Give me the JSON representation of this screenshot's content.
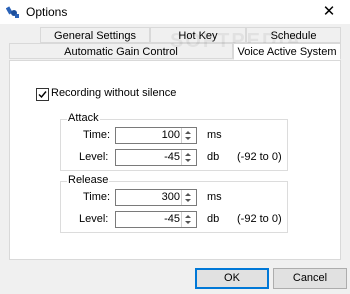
{
  "window": {
    "title": "Options",
    "icon": "app-satellite-icon",
    "close_glyph": "✕"
  },
  "tabs": {
    "row1": [
      "General Settings",
      "Hot Key",
      "Schedule"
    ],
    "row2": [
      "Automatic Gain Control",
      "Voice Active System"
    ],
    "active": "Voice Active System"
  },
  "voice": {
    "recording_without_silence_label": "Recording without silence",
    "recording_without_silence_checked": true,
    "attack": {
      "title": "Attack",
      "time_label": "Time:",
      "time_value": "100",
      "time_unit": "ms",
      "level_label": "Level:",
      "level_value": "-45",
      "level_unit": "db",
      "level_range": "(-92 to 0)"
    },
    "release": {
      "title": "Release",
      "time_label": "Time:",
      "time_value": "300",
      "time_unit": "ms",
      "level_label": "Level:",
      "level_value": "-45",
      "level_unit": "db",
      "level_range": "(-92 to 0)"
    }
  },
  "buttons": {
    "ok": "OK",
    "cancel": "Cancel"
  },
  "watermark": "SOFTPEDIA",
  "colors": {
    "accent": "#0078d7",
    "border": "#d9d9d9",
    "panel": "#ffffff",
    "dialog": "#f0f0f0"
  }
}
